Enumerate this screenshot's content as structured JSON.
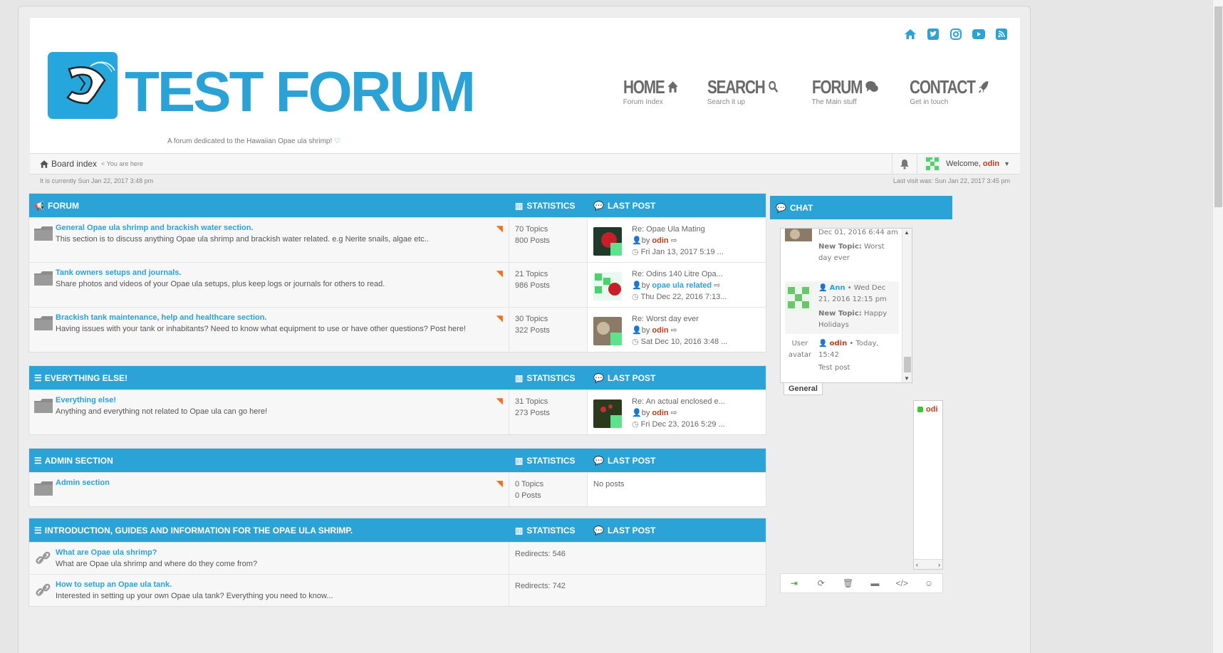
{
  "header": {
    "site_title": "TEST FORUM",
    "site_description": "A forum dedicated to the Hawaiian Opae ula shrimp!",
    "social_icons": [
      "home-icon",
      "twitter-icon",
      "instagram-icon",
      "youtube-icon",
      "rss-icon"
    ],
    "nav": [
      {
        "label": "HOME",
        "sub": "Forum Index",
        "icon": "home-icon"
      },
      {
        "label": "SEARCH",
        "sub": "Search it up",
        "icon": "search-icon"
      },
      {
        "label": "FORUM",
        "sub": "The Main stuff",
        "icon": "comments-icon"
      },
      {
        "label": "CONTACT",
        "sub": "Get in touch",
        "icon": "rocket-icon"
      }
    ]
  },
  "navbar": {
    "board_index": "Board index",
    "you_are_here": "< You are here",
    "welcome": "Welcome,",
    "username": "odin"
  },
  "timebar": {
    "current_time": "It is currently Sun Jan 22, 2017 3:48 pm",
    "last_visit": "Last visit was: Sun Jan 22, 2017 3:45 pm"
  },
  "categories": [
    {
      "title": "FORUM",
      "stats_label": "STATISTICS",
      "last_post_label": "LAST POST",
      "forums": [
        {
          "title": "General Opae ula shrimp and brackish water section.",
          "desc": "This section is to discuss anything Opae ula shrimp and brackish water related. e.g Nerite snails, algae etc..",
          "topics": "70 Topics",
          "posts": "800 Posts",
          "lp_title": "Re: Opae Ula Mating",
          "lp_by": "by",
          "lp_user": "odin",
          "lp_time": "Fri Jan 13, 2017 5:19 ..."
        },
        {
          "title": "Tank owners setups and journals.",
          "desc": "Share photos and videos of your Opae ula setups, plus keep logs or journals for others to read.",
          "topics": "21 Topics",
          "posts": "986 Posts",
          "lp_title": "Re: Odins 140 Litre Opa...",
          "lp_by": "by",
          "lp_user": "opae ula related",
          "lp_time": "Thu Dec 22, 2016 7:13..."
        },
        {
          "title": "Brackish tank maintenance, help and healthcare section.",
          "desc": "Having issues with your tank or inhabitants? Need to know what equipment to use or have other questions? Post here!",
          "topics": "30 Topics",
          "posts": "322 Posts",
          "lp_title": "Re: Worst day ever",
          "lp_by": "by",
          "lp_user": "odin",
          "lp_time": "Sat Dec 10, 2016 3:48 ..."
        }
      ]
    },
    {
      "title": "EVERYTHING ELSE!",
      "stats_label": "STATISTICS",
      "last_post_label": "LAST POST",
      "forums": [
        {
          "title": "Everything else!",
          "desc": "Anything and everything not related to Opae ula can go here!",
          "topics": "31 Topics",
          "posts": "273 Posts",
          "lp_title": "Re: An actual enclosed e...",
          "lp_by": "by",
          "lp_user": "odin",
          "lp_time": "Fri Dec 23, 2016 5:29 ..."
        }
      ]
    },
    {
      "title": "ADMIN SECTION",
      "stats_label": "STATISTICS",
      "last_post_label": "LAST POST",
      "forums": [
        {
          "title": "Admin section",
          "desc": "",
          "topics": "0 Topics",
          "posts": "0 Posts",
          "no_posts": "No posts"
        }
      ]
    },
    {
      "title": "INTRODUCTION, GUIDES AND INFORMATION FOR THE OPAE ULA SHRIMP.",
      "stats_label": "STATISTICS",
      "last_post_label": "LAST POST",
      "forums": [
        {
          "title": "What are Opae ula shrimp?",
          "desc": "What are Opae ula shrimp and where do they come from?",
          "redirects": "Redirects: 546"
        },
        {
          "title": "How to setup an Opae ula tank.",
          "desc": "Interested in setting up your own Opae ula tank? Everything you need to know...",
          "redirects": "Redirects: 742"
        }
      ]
    }
  ],
  "chat": {
    "title": "CHAT",
    "tab": "General",
    "messages": [
      {
        "time": "Dec 01, 2016 6:44 am",
        "label": "New Topic:",
        "text": "Worst day ever"
      },
      {
        "user": "Ann",
        "time": "Wed Dec 21, 2016 12:15 pm",
        "label": "New Topic:",
        "text": "Happy Holidays"
      },
      {
        "avatar_alt": "User avatar",
        "user": "odin",
        "time": "Today, 15:42",
        "text": "Test post"
      }
    ],
    "online_user": "odi"
  },
  "colors": {
    "accent": "#2ba3d6",
    "username": "#bd3b1b",
    "rss": "#f26f21"
  }
}
